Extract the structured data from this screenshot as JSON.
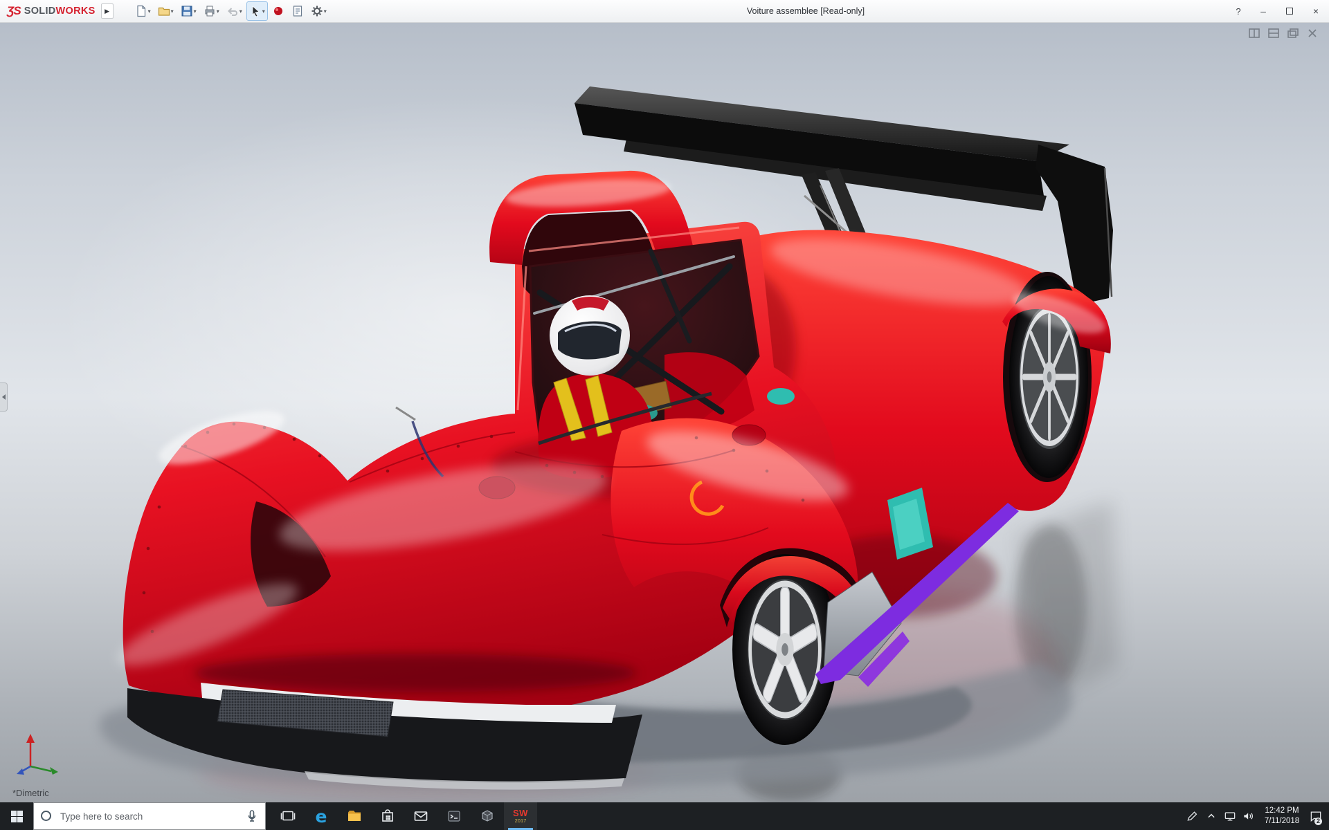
{
  "colors": {
    "car_red": "#e20a1d",
    "car_red_dark": "#8f000f",
    "wing_black": "#121212",
    "accent_teal": "#2fbdb0",
    "accent_purple": "#7d2ce0",
    "harness_yellow": "#e3c01c",
    "taskbar_bg": "#1d2023",
    "titlebar_bg": "#f4f5f6",
    "background_top": "#b6bec9",
    "background_mid": "#e1e5ea",
    "background_bottom": "#9da2a8"
  },
  "window": {
    "title": "Voiture assemblee [Read-only]",
    "brand": {
      "mark": "ƷS",
      "name_left": "SOLID",
      "name_right": "WORKS"
    },
    "controls": {
      "help": "?",
      "minimize": "–",
      "close": "×"
    }
  },
  "toolbar": {
    "icons": [
      "new-document",
      "open",
      "save",
      "print",
      "undo",
      "select-cursor",
      "rebuild",
      "file-properties",
      "options-gear"
    ]
  },
  "viewport": {
    "view_orientation_label": "*Dimetric",
    "window_controls": [
      "split-vertical",
      "split-horizontal",
      "restore",
      "close"
    ],
    "model": {
      "description": "Red open-cockpit prototype race car with driver, black rear wing, silver wheels",
      "body_color": "#e20a1d",
      "wing_color": "#121212"
    }
  },
  "taskbar": {
    "search": {
      "placeholder": "Type here to search"
    },
    "apps": [
      "task-view",
      "edge",
      "file-explorer",
      "store",
      "mail",
      "terminal",
      "cube-app",
      "solidworks"
    ],
    "solidworks": {
      "label": "SW",
      "year": "2017"
    },
    "tray": {
      "clock_time": "12:42 PM",
      "clock_date": "7/11/2018",
      "notification_count": "2"
    }
  }
}
